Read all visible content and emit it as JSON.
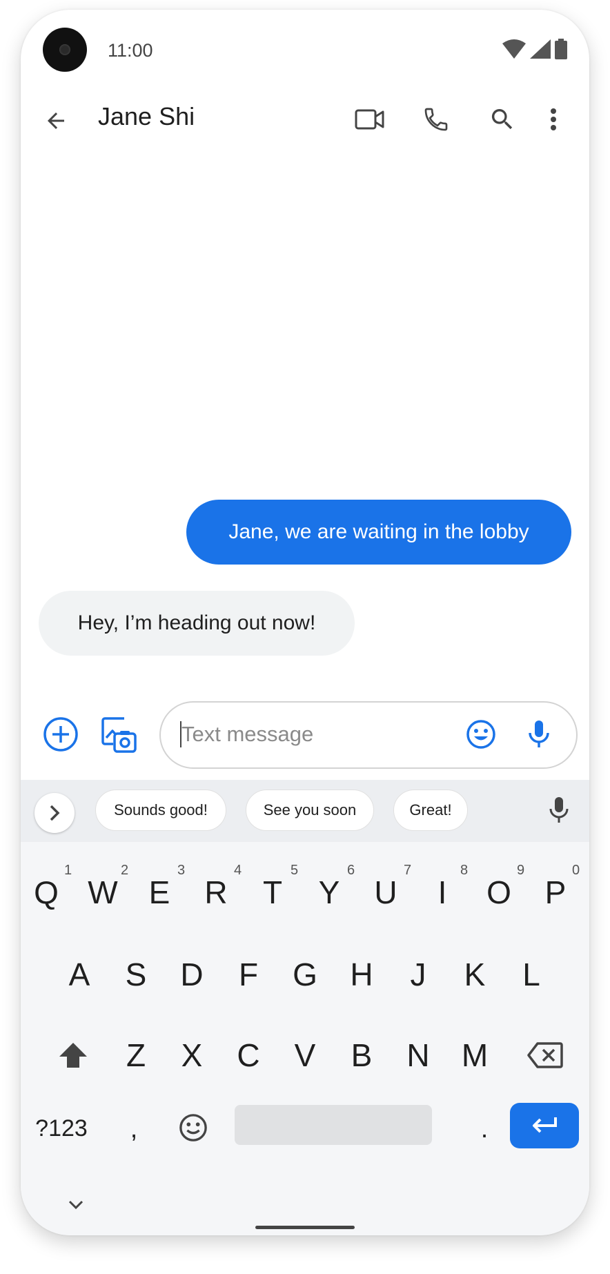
{
  "status_bar": {
    "time": "11:00"
  },
  "header": {
    "title": "Jane Shi",
    "icons": [
      "back-arrow-icon",
      "video-call-icon",
      "phone-icon",
      "search-icon",
      "more-vert-icon"
    ]
  },
  "messages": [
    {
      "direction": "outgoing",
      "text": "Jane, we are waiting in the lobby"
    },
    {
      "direction": "incoming",
      "text": "Hey, I’m heading out now!"
    }
  ],
  "compose": {
    "placeholder": "Text message",
    "icons": [
      "add-circle-icon",
      "gallery-camera-icon",
      "emoji-icon",
      "mic-icon"
    ]
  },
  "suggestions": [
    "Sounds good!",
    "See you soon",
    "Great!"
  ],
  "keyboard": {
    "row1": [
      "Q",
      "W",
      "E",
      "R",
      "T",
      "Y",
      "U",
      "I",
      "O",
      "P"
    ],
    "row1_hints": [
      "1",
      "2",
      "3",
      "4",
      "5",
      "6",
      "7",
      "8",
      "9",
      "0"
    ],
    "row2": [
      "A",
      "S",
      "D",
      "F",
      "G",
      "H",
      "J",
      "K",
      "L"
    ],
    "row3": [
      "Z",
      "X",
      "C",
      "V",
      "B",
      "N",
      "M"
    ],
    "symbols_label": "?123",
    "comma": ",",
    "period": "."
  },
  "colors": {
    "accent": "#1a73e8",
    "incoming_bubble": "#f1f3f4"
  }
}
